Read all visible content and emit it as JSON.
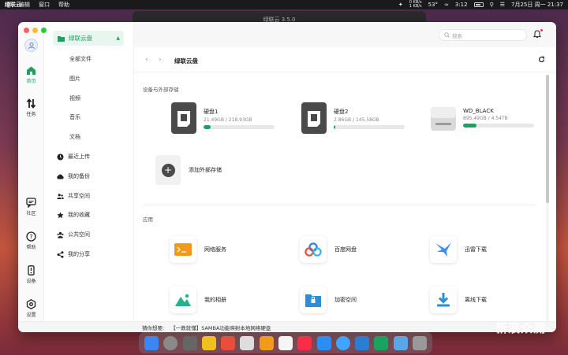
{
  "menubar": {
    "app_name": "绿联云",
    "menus": [
      "编辑",
      "窗口",
      "帮助"
    ],
    "net_up": "0 KB/s",
    "net_down": "1 KB/s",
    "temp": "53°",
    "time_elapsed": "3:12",
    "datetime": "7月25日 周一 21:37"
  },
  "background_window": {
    "title": "绿联云 3.5.0"
  },
  "rail": {
    "items": [
      {
        "label": "首页",
        "icon": "home-icon"
      },
      {
        "label": "任务",
        "icon": "transfer-icon"
      },
      {
        "label": "社区",
        "icon": "chat-icon"
      },
      {
        "label": "帮助",
        "icon": "help-icon"
      },
      {
        "label": "设备",
        "icon": "device-icon"
      },
      {
        "label": "设置",
        "icon": "settings-icon"
      }
    ]
  },
  "sidebar": {
    "header": "绿联云盘",
    "sub_items": [
      "全部文件",
      "图片",
      "视频",
      "音乐",
      "文档"
    ],
    "items": [
      {
        "label": "最近上传",
        "icon": "clock-icon"
      },
      {
        "label": "我的备份",
        "icon": "backup-icon"
      },
      {
        "label": "共享空间",
        "icon": "users-icon"
      },
      {
        "label": "我的收藏",
        "icon": "star-icon"
      },
      {
        "label": "公共空间",
        "icon": "group-icon"
      },
      {
        "label": "我的分享",
        "icon": "share-icon"
      }
    ]
  },
  "main": {
    "search_placeholder": "搜索",
    "breadcrumb": "绿联云盘",
    "storage_section": "设备与外部存储",
    "disks": [
      {
        "name": "硬盘1",
        "size": "21.49GB / 218.93GB",
        "used_fraction": 0.098
      },
      {
        "name": "硬盘2",
        "size": "2.86GB / 145.58GB",
        "used_fraction": 0.02
      },
      {
        "name": "WD_BLACK",
        "size": "895.49GB / 4.54TB",
        "used_fraction": 0.19
      }
    ],
    "add_storage": "添加外部存储",
    "apps_section": "应用",
    "apps": [
      {
        "label": "网络服务",
        "icon": "network-service-icon"
      },
      {
        "label": "百度网盘",
        "icon": "baidu-netdisk-icon"
      },
      {
        "label": "迅雷下载",
        "icon": "thunder-icon"
      },
      {
        "label": "我的相册",
        "icon": "photo-album-icon"
      },
      {
        "label": "加密空间",
        "icon": "lock-folder-icon"
      },
      {
        "label": "离线下载",
        "icon": "download-icon"
      }
    ]
  },
  "status_bar": {
    "prefix": "猜你想要:",
    "suggestion": "【一教就懂】SAMBA功能映射本地网络硬盘"
  },
  "watermark": "新浪众测",
  "colors": {
    "accent": "#1aa261",
    "accent_bg": "#e9f6ef"
  }
}
